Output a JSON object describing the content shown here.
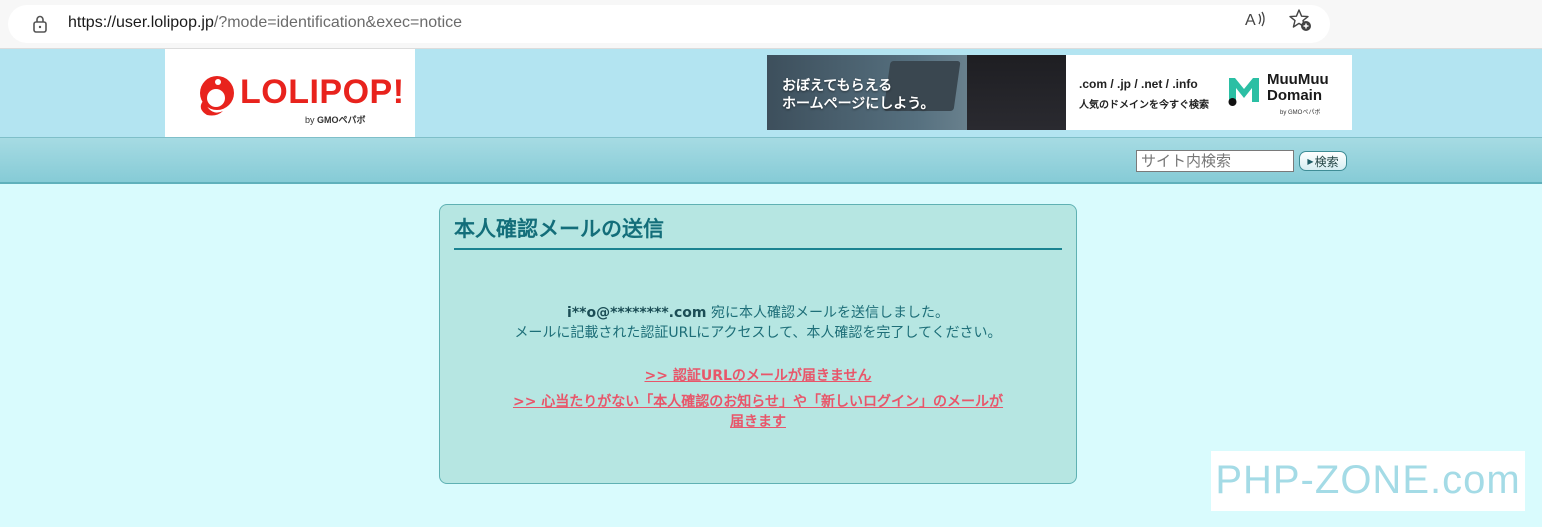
{
  "browser": {
    "url_host": "https://user.lolipop.jp",
    "url_path": "/?mode=identification&exec=notice"
  },
  "header": {
    "logo_text": "LOLIPOP!",
    "logo_by": "by",
    "logo_company": "GMOペパボ",
    "banner": {
      "line1": "おぼえてもらえる",
      "line2": "ホームページにしよう。",
      "domains": ".com / .jp / .net / .info",
      "domains_sub": "人気のドメインを今すぐ検索",
      "brand": "MuuMuu Domain",
      "brand_line1": "MuuMuu",
      "brand_line2": "Domain",
      "brand_by": "by GMOペパボ"
    }
  },
  "nav": {
    "search_placeholder": "サイト内検索",
    "search_button": "検索"
  },
  "panel": {
    "title": "本人確認メールの送信",
    "email": "i**o@********.com",
    "message1_suffix": " 宛に本人確認メールを送信しました。",
    "message2": "メールに記載された認証URLにアクセスして、本人確認を完了してください。",
    "link1": ">>  認証URLのメールが届きません",
    "link2_line1": ">>  心当たりがない「本人確認のお知らせ」や「新しいログイン」のメールが",
    "link2_line2": "届きます"
  },
  "watermark": "PHP-ZONE.com",
  "colors": {
    "page_bg": "#d9fbfd",
    "header_bg": "#b3e4f1",
    "panel_bg": "#b6e6e2",
    "title_color": "#136e7a",
    "link_color": "#e8566a",
    "logo_red": "#e8231d"
  }
}
